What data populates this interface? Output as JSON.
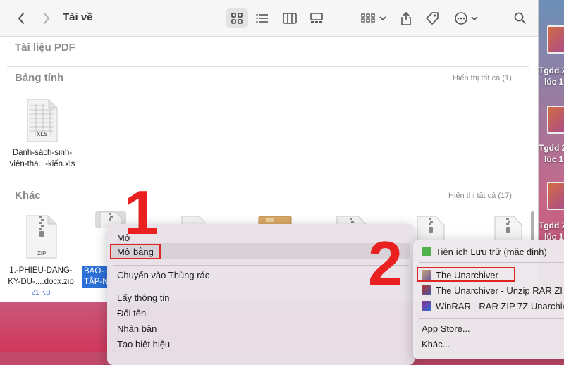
{
  "window": {
    "title": "Tài về"
  },
  "sections": {
    "pdf": {
      "title": "Tài liệu PDF"
    },
    "spreadsheet": {
      "title": "Bảng tính",
      "show_all": "Hiển thị tất cả (1)"
    },
    "other": {
      "title": "Khác",
      "show_all": "Hiển thị tất cả (17)"
    }
  },
  "files": {
    "xls": {
      "name_line1": "Danh-sách-sinh-",
      "name_line2": "viên-tha...-kiến.xls",
      "badge": "XLS"
    },
    "zip": {
      "name_line1": "1.-PHIEU-DANG-",
      "name_line2": "KY-DU-....docx.zip",
      "size": "21 KB",
      "badge": "ZIP"
    },
    "selected": {
      "name_line1": "BÁO-",
      "name_line2": "TẬP-N"
    }
  },
  "context_menu": {
    "open": "Mở",
    "open_with": "Mở bằng",
    "move_to_trash": "Chuyển vào Thùng rác",
    "get_info": "Lấy thông tin",
    "rename": "Đổi tên",
    "duplicate": "Nhân bản",
    "make_alias": "Tạo biệt hiệu"
  },
  "submenu": {
    "archive_utility": "Tiện ích Lưu trữ (mặc định)",
    "unarchiver": "The Unarchiver",
    "unarchiver_unzip": "The Unarchiver - Unzip RAR ZI",
    "winrar": "WinRAR - RAR ZIP 7Z Unarchiv",
    "app_store": "App Store...",
    "other": "Khác..."
  },
  "desktop": {
    "label1": "Tgdd 2",
    "label1b": "lúc 1",
    "label2": "Tgdd 2",
    "label2b": "lúc 1",
    "label3": "Tgdd 2",
    "label3b": "lúc 1"
  },
  "callouts": {
    "one": "1",
    "two": "2"
  },
  "colors": {
    "accent": "#2c6fd6",
    "highlight_box": "#e02323",
    "callout": "#e82020"
  }
}
